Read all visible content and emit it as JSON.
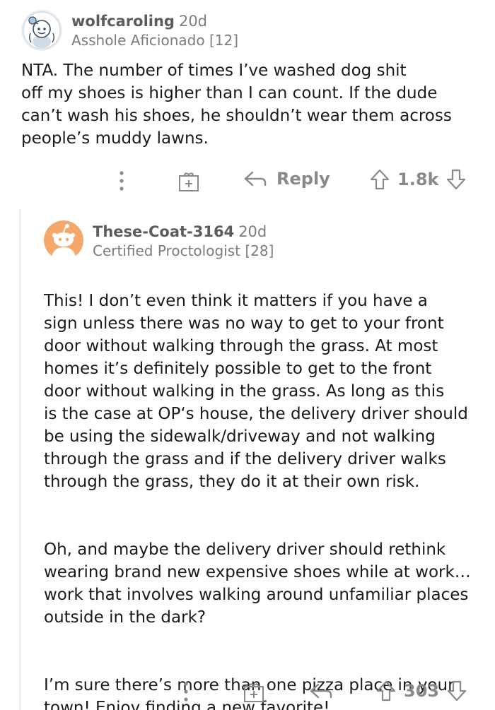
{
  "top_comment": {
    "username": "wolfcaroling",
    "age": "20d",
    "flair": "Asshole Aficionado [12]",
    "body": "NTA. The number of times I’ve washed dog shit\noff my shoes is higher than I can count. If the dude\ncan’t wash his shoes, he shouldn’t wear them across\npeople’s muddy lawns.",
    "actions": {
      "more_icon": "more-vertical-icon",
      "award_icon": "gift-icon",
      "reply_icon": "reply-arrow-icon",
      "reply_label": "Reply",
      "upvote_icon": "upvote-arrow-icon",
      "score": "1.8k",
      "downvote_icon": "downvote-arrow-icon"
    }
  },
  "reply_comment": {
    "username": "These-Coat-3164",
    "age": "20d",
    "flair": "Certified Proctologist [28]",
    "paragraphs": [
      "This! I don’t even think it matters if you have a\nsign unless there was no way to get to your front\ndoor without walking through the grass. At most\nhomes it’s definitely possible to get to the front\ndoor without walking in the grass.  As long as this\nis the case at OP‘s house, the delivery driver should\nbe using the sidewalk/driveway and not walking\nthrough the grass and if the delivery driver walks\nthrough the grass, they do it at their own risk.",
      "Oh, and maybe the delivery driver should rethink\nwearing brand new expensive shoes while at work…\nwork that involves walking around unfamiliar places\noutside in the dark?",
      "I’m sure there’s more than one pizza place in your\ntown!  Enjoy finding a new favorite!"
    ],
    "actions": {
      "more_icon": "more-vertical-icon",
      "award_icon": "gift-icon",
      "reply_icon": "reply-arrow-icon",
      "upvote_icon": "upvote-arrow-icon",
      "score": "303",
      "downvote_icon": "downvote-arrow-icon"
    }
  },
  "colors": {
    "text": "#1a1a1b",
    "muted": "#878a8c",
    "username": "#5c5c5c",
    "avatar2_bg": "#f5a86b",
    "thread_line": "#edeff1"
  }
}
